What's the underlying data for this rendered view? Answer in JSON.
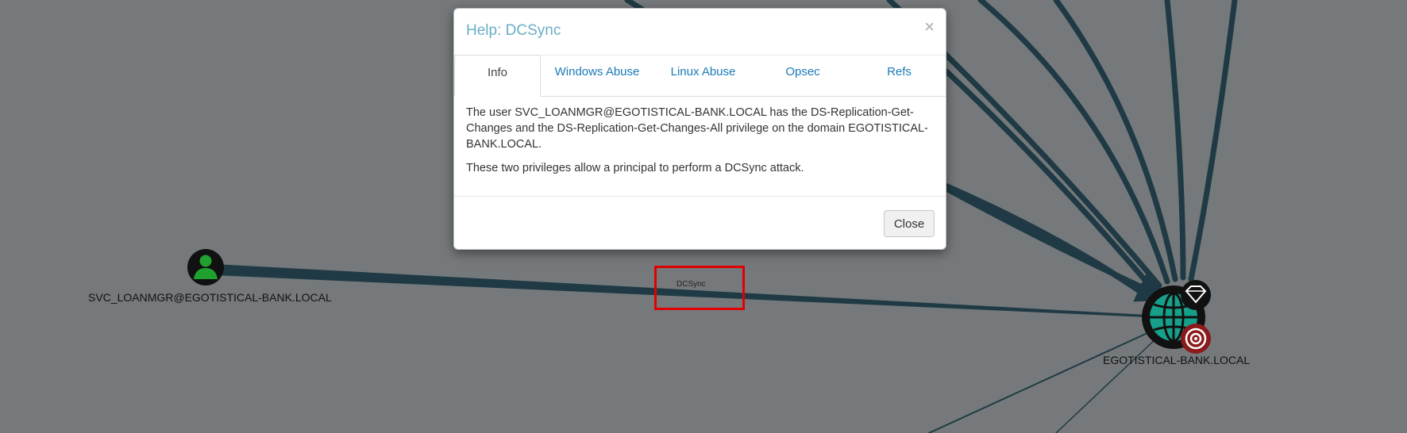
{
  "graph": {
    "source_node": {
      "label": "SVC_LOANMGR@EGOTISTICAL-BANK.LOCAL",
      "icon": "user-icon",
      "color": "#1fa02f"
    },
    "target_node": {
      "label": "EGOTISTICAL-BANK.LOCAL",
      "icon": "domain-globe-icon",
      "color": "#17a089"
    },
    "edge_label": "DCSync",
    "edge_color": "#1f3a44",
    "highlight_color": "#e00000"
  },
  "modal": {
    "title": "Help: DCSync",
    "close_symbol": "×",
    "tabs": [
      {
        "label": "Info",
        "active": true
      },
      {
        "label": "Windows Abuse",
        "active": false
      },
      {
        "label": "Linux Abuse",
        "active": false
      },
      {
        "label": "Opsec",
        "active": false
      },
      {
        "label": "Refs",
        "active": false
      }
    ],
    "body": {
      "paragraph_1": "The user SVC_LOANMGR@EGOTISTICAL-BANK.LOCAL has the DS-Replication-Get-Changes and the DS-Replication-Get-Changes-All privilege on the domain EGOTISTICAL-BANK.LOCAL.",
      "paragraph_2": "These two privileges allow a principal to perform a DCSync attack."
    },
    "close_button": "Close"
  }
}
